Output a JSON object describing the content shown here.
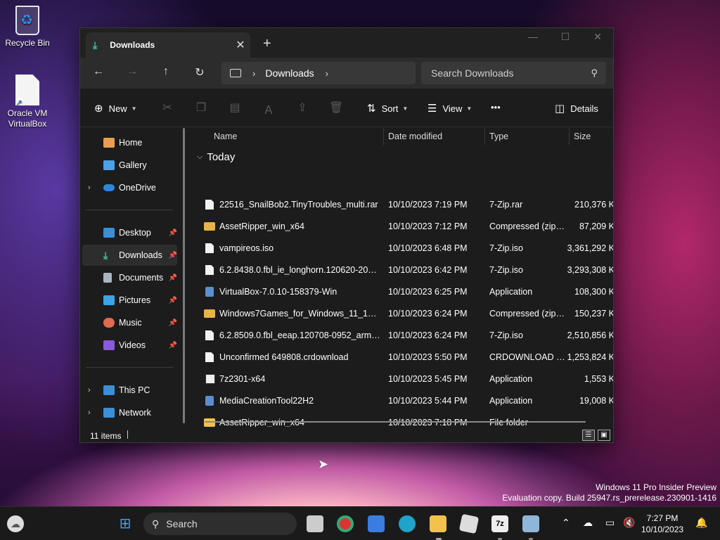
{
  "desktop": {
    "icons": [
      {
        "label": "Recycle Bin",
        "icon": "recycle-bin-icon"
      },
      {
        "label": "Oracle VM VirtualBox",
        "icon": "shortcut-file-icon"
      }
    ],
    "watermark_line1": "Windows 11 Pro Insider Preview",
    "watermark_line2": "Evaluation copy. Build 25947.rs_prerelease.230901-1416"
  },
  "window": {
    "tab_title": "Downloads",
    "controls": {
      "minimize": "—",
      "maximize": "☐",
      "close": "✕"
    }
  },
  "navbar": {
    "breadcrumb": [
      "Downloads"
    ],
    "search_placeholder": "Search Downloads"
  },
  "cmdbar": {
    "new_label": "New",
    "sort_label": "Sort",
    "view_label": "View",
    "more_label": "•••",
    "details_label": "Details"
  },
  "sidebar": {
    "items": [
      {
        "label": "Home",
        "icon": "home-icon",
        "color": "#e8a050"
      },
      {
        "label": "Gallery",
        "icon": "gallery-icon",
        "color": "#4aa3e8"
      },
      {
        "label": "OneDrive",
        "icon": "onedrive-icon",
        "color": "#2f86e0",
        "expandable": true
      },
      {
        "label": "Desktop",
        "icon": "desktop-icon",
        "color": "#3b8fd8",
        "pinned": true
      },
      {
        "label": "Downloads",
        "icon": "downloads-icon",
        "color": "#40c6a0",
        "pinned": true,
        "selected": true
      },
      {
        "label": "Documents",
        "icon": "documents-icon",
        "color": "#a9b4c2",
        "pinned": true
      },
      {
        "label": "Pictures",
        "icon": "pictures-icon",
        "color": "#3ca3e6",
        "pinned": true
      },
      {
        "label": "Music",
        "icon": "music-icon",
        "color": "#e06a52",
        "pinned": true
      },
      {
        "label": "Videos",
        "icon": "videos-icon",
        "color": "#8a5ad8",
        "pinned": true
      },
      {
        "label": "This PC",
        "icon": "this-pc-icon",
        "color": "#3b8fd8",
        "expandable": true
      },
      {
        "label": "Network",
        "icon": "network-icon",
        "color": "#3b8fd8",
        "expandable": true
      }
    ]
  },
  "table": {
    "columns": [
      "Name",
      "Date modified",
      "Type",
      "Size"
    ],
    "group": "Today",
    "rows": [
      {
        "name": "22516_SnailBob2.TinyTroubles_multi.rar",
        "date": "10/10/2023 7:19 PM",
        "type": "7-Zip.rar",
        "size": "210,376 K",
        "icon": "file"
      },
      {
        "name": "AssetRipper_win_x64",
        "date": "10/10/2023 7:12 PM",
        "type": "Compressed (zipp...",
        "size": "87,209 K",
        "icon": "zip"
      },
      {
        "name": "vampireos.iso",
        "date": "10/10/2023 6:48 PM",
        "type": "7-Zip.iso",
        "size": "3,361,292 K",
        "icon": "file"
      },
      {
        "name": "6.2.8438.0.fbl_ie_longhorn.120620-2000_a...",
        "date": "10/10/2023 6:42 PM",
        "type": "7-Zip.iso",
        "size": "3,293,308 K",
        "icon": "file"
      },
      {
        "name": "VirtualBox-7.0.10-158379-Win",
        "date": "10/10/2023 6:25 PM",
        "type": "Application",
        "size": "108,300 K",
        "icon": "app"
      },
      {
        "name": "Windows7Games_for_Windows_11_10_8",
        "date": "10/10/2023 6:24 PM",
        "type": "Compressed (zipp...",
        "size": "150,237 K",
        "icon": "zip"
      },
      {
        "name": "6.2.8509.0.fbl_eeap.120708-0952_armfre_c...",
        "date": "10/10/2023 6:24 PM",
        "type": "7-Zip.iso",
        "size": "2,510,856 K",
        "icon": "file"
      },
      {
        "name": "Unconfirmed 649808.crdownload",
        "date": "10/10/2023 5:50 PM",
        "type": "CRDOWNLOAD File",
        "size": "1,253,824 K",
        "icon": "file"
      },
      {
        "name": "7z2301-x64",
        "date": "10/10/2023 5:45 PM",
        "type": "Application",
        "size": "1,553 K",
        "icon": "7z"
      },
      {
        "name": "MediaCreationTool22H2",
        "date": "10/10/2023 5:44 PM",
        "type": "Application",
        "size": "19,008 K",
        "icon": "app"
      },
      {
        "name": "AssetRipper_win_x64",
        "date": "10/10/2023 7:18 PM",
        "type": "File folder",
        "size": "",
        "icon": "folder"
      }
    ]
  },
  "status": {
    "item_count": "11 items"
  },
  "taskbar": {
    "search_label": "Search",
    "apps": [
      "start-icon",
      "task-view-icon",
      "chrome-icon",
      "store-icon",
      "edge-icon",
      "file-explorer-icon",
      "roblox-icon",
      "7zip-icon",
      "perf-monitor-icon"
    ],
    "time": "7:27 PM",
    "date": "10/10/2023"
  }
}
